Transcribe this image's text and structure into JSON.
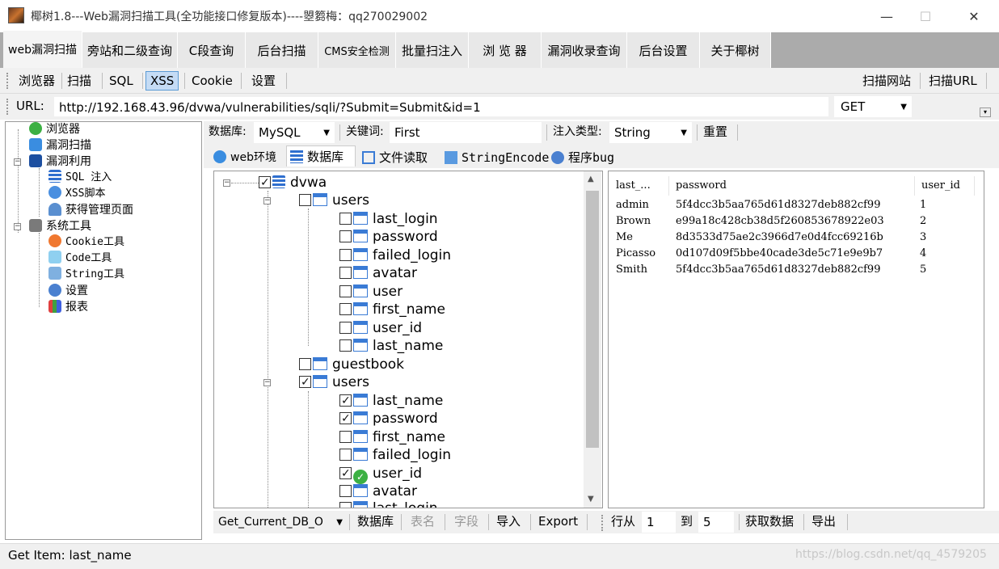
{
  "window": {
    "title": "椰树1.8---Web漏洞扫描工具(全功能接口修复版本)----曌篘梅：qq270029002",
    "minimize": "—",
    "maximize": "☐",
    "close": "✕"
  },
  "main_tabs": [
    "web漏洞扫描",
    "旁站和二级查询",
    "C段查询",
    "后台扫描",
    "CMS安全检测",
    "批量扫注入",
    "浏 览 器",
    "漏洞收录查询",
    "后台设置",
    "关于椰树"
  ],
  "toolbar": {
    "items": [
      "浏览器",
      "扫描",
      "SQL",
      "XSS",
      "Cookie",
      "设置"
    ],
    "right_items": [
      "扫描网站",
      "扫描URL"
    ]
  },
  "url_bar": {
    "label": "URL:",
    "value": "http://192.168.43.96/dvwa/vulnerabilities/sqli/?Submit=Submit&id=1",
    "method": "GET"
  },
  "left_tree": [
    {
      "label": "浏览器",
      "icon": "check-circle-icon"
    },
    {
      "label": "漏洞扫描",
      "icon": "scan-icon"
    },
    {
      "label": "漏洞利用",
      "icon": "exploit-icon"
    },
    {
      "label": "SQL 注入",
      "icon": "database-icon"
    },
    {
      "label": "XSS脚本",
      "icon": "xss-icon"
    },
    {
      "label": "获得管理页面",
      "icon": "user-icon"
    },
    {
      "label": "系统工具",
      "icon": "tools-icon"
    },
    {
      "label": "Cookie工具",
      "icon": "cookie-icon"
    },
    {
      "label": "Code工具",
      "icon": "code-icon"
    },
    {
      "label": "String工具",
      "icon": "string-icon"
    },
    {
      "label": "设置",
      "icon": "gear-icon"
    },
    {
      "label": "报表",
      "icon": "chart-icon"
    }
  ],
  "db_bar": {
    "db_label": "数据库:",
    "db_value": "MySQL",
    "keyword_label": "关键词:",
    "keyword_value": "First",
    "inject_label": "注入类型:",
    "inject_value": "String",
    "reset": "重置"
  },
  "sub_tabs": [
    "web环境",
    "数据库",
    "文件读取",
    "StringEncode",
    "程序bug"
  ],
  "db_tree": {
    "root": "dvwa",
    "tables": [
      {
        "name": "users",
        "checked": false,
        "columns": [
          {
            "name": "last_login",
            "checked": false
          },
          {
            "name": "password",
            "checked": false
          },
          {
            "name": "failed_login",
            "checked": false
          },
          {
            "name": "avatar",
            "checked": false
          },
          {
            "name": "user",
            "checked": false
          },
          {
            "name": "first_name",
            "checked": false
          },
          {
            "name": "user_id",
            "checked": false
          },
          {
            "name": "last_name",
            "checked": false
          }
        ]
      },
      {
        "name": "guestbook",
        "checked": false,
        "columns": []
      },
      {
        "name": "users",
        "checked": true,
        "columns": [
          {
            "name": "last_name",
            "checked": true
          },
          {
            "name": "password",
            "checked": true
          },
          {
            "name": "first_name",
            "checked": false
          },
          {
            "name": "failed_login",
            "checked": false
          },
          {
            "name": "user_id",
            "checked": true
          },
          {
            "name": "avatar",
            "checked": false
          },
          {
            "name": "last_login",
            "checked": false
          }
        ]
      }
    ]
  },
  "results": {
    "headers": [
      "last_...",
      "password",
      "user_id"
    ],
    "rows": [
      [
        "admin",
        "5f4dcc3b5aa765d61d8327deb882cf99",
        "1"
      ],
      [
        "Brown",
        "e99a18c428cb38d5f260853678922e03",
        "2"
      ],
      [
        "Me",
        "8d3533d75ae2c3966d7e0d4fcc69216b",
        "3"
      ],
      [
        "Picasso",
        "0d107d09f5bbe40cade3de5c71e9e9b7",
        "4"
      ],
      [
        "Smith",
        "5f4dcc3b5aa765d61d8327deb882cf99",
        "5"
      ]
    ]
  },
  "bottom_bar": {
    "method_select": "Get_Current_DB_O",
    "buttons": [
      "数据库",
      "表名",
      "字段",
      "导入",
      "Export"
    ],
    "row_from_label": "行从",
    "row_from": "1",
    "row_to_label": "到",
    "row_to": "5",
    "fetch": "获取数据",
    "export": "导出"
  },
  "status": {
    "text": "Get Item: last_name",
    "watermark": "https://blog.csdn.net/qq_4579205"
  }
}
